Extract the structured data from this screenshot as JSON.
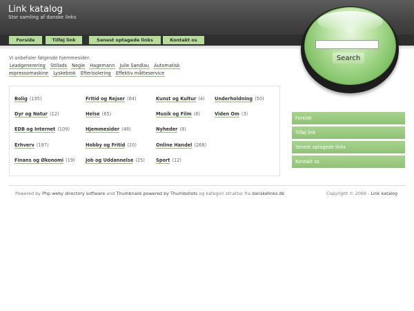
{
  "header": {
    "title": "Link katalog",
    "subtitle": "Stor samling af danske links"
  },
  "nav": {
    "items": [
      "Forside",
      "Tilføj link",
      "Senest optagede links",
      "Kontakt os"
    ]
  },
  "search": {
    "placeholder": "",
    "button_label": "Search"
  },
  "recommended": {
    "title": "Vi anbefaler følgende hjemmesider:",
    "links": [
      "Leadgenerering",
      "Stillads",
      "Negle",
      "Hagemann",
      "Julie Sandlau",
      "Automatisk espressomaskine",
      "Lyskebrok",
      "Efterisolering",
      "Effektiv måtteservice"
    ]
  },
  "categories": [
    {
      "name": "Bolig",
      "count": "(195)"
    },
    {
      "name": "Fritid og Rejser",
      "count": "(64)"
    },
    {
      "name": "Kunst og Kultur",
      "count": "(4)"
    },
    {
      "name": "Underholdning",
      "count": "(50)"
    },
    {
      "name": "Dyr og Natur",
      "count": "(12)"
    },
    {
      "name": "Helse",
      "count": "(65)"
    },
    {
      "name": "Musik og Film",
      "count": "(8)"
    },
    {
      "name": "Viden Om",
      "count": "(3)"
    },
    {
      "name": "EDB og Internet",
      "count": "(109)"
    },
    {
      "name": "Hjemmesider",
      "count": "(48)"
    },
    {
      "name": "Nyheder",
      "count": "(8)"
    },
    {
      "name": "Erhverv",
      "count": "(197)"
    },
    {
      "name": "Hobby og Fritid",
      "count": "(20)"
    },
    {
      "name": "Online Handel",
      "count": "(268)"
    },
    {
      "name": "Finans og Økonomi",
      "count": "(19)"
    },
    {
      "name": "Job og Uddannelse",
      "count": "(25)"
    },
    {
      "name": "Sport",
      "count": "(12)"
    }
  ],
  "sidebar": {
    "items": [
      "Forside",
      "Tilføj link",
      "Senest optagede links",
      "Kontakt os"
    ]
  },
  "footer": {
    "powered_prefix": "Powered by",
    "software_link": "Php weby directory software",
    "and_text": "and",
    "thumbnails_link": "Thumbnails powered by Thumbshots",
    "category_text": "og kategori struktur fra",
    "danskelinks_link": "danskelinks.dk",
    "copyright_text": "Copyright © 2009 -",
    "copyright_link": "Link katalog"
  },
  "colors": {
    "accent_green": "#a6d48c",
    "header_dark": "#444444"
  }
}
